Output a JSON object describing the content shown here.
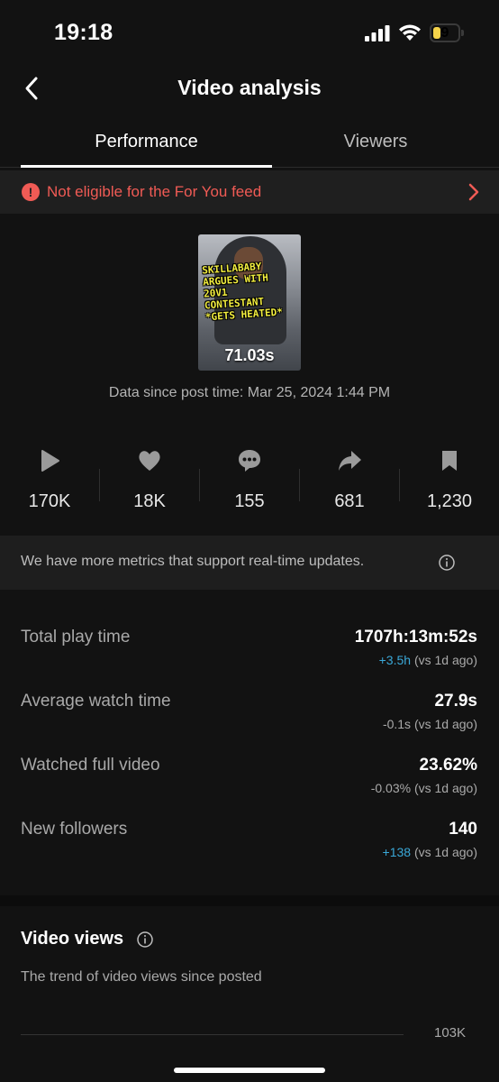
{
  "status_bar": {
    "time": "19:18",
    "battery_level": "9",
    "battery_color": "#f5d34a"
  },
  "header": {
    "title": "Video analysis"
  },
  "tabs": [
    {
      "label": "Performance",
      "active": true
    },
    {
      "label": "Viewers",
      "active": false
    }
  ],
  "alert": {
    "text": "Not eligible for the For You feed",
    "color": "#f05b55"
  },
  "video": {
    "caption_lines": [
      "SKILLABABY",
      "ARGUES WITH",
      "20V1",
      "CONTESTANT",
      "*GETS HEATED*"
    ],
    "duration": "71.03s",
    "data_since": "Data since post time: Mar 25, 2024 1:44 PM"
  },
  "metrics": [
    {
      "icon": "play-icon",
      "value": "170K"
    },
    {
      "icon": "heart-icon",
      "value": "18K"
    },
    {
      "icon": "comment-icon",
      "value": "155"
    },
    {
      "icon": "share-icon",
      "value": "681"
    },
    {
      "icon": "bookmark-icon",
      "value": "1,230"
    }
  ],
  "realtime_notice": "We have more metrics that support real-time updates.",
  "stats": [
    {
      "label": "Total play time",
      "value": "1707h:13m:52s",
      "change": "+3.5h",
      "suffix": " (vs 1d ago)",
      "positive": true
    },
    {
      "label": "Average watch time",
      "value": "27.9s",
      "change": "-0.1s",
      "suffix": " (vs 1d ago)",
      "positive": false
    },
    {
      "label": "Watched full video",
      "value": "23.62%",
      "change": "-0.03%",
      "suffix": " (vs 1d ago)",
      "positive": false
    },
    {
      "label": "New followers",
      "value": "140",
      "change": "+138",
      "suffix": " (vs 1d ago)",
      "positive": true
    }
  ],
  "video_views": {
    "title": "Video views",
    "subtitle": "The trend of video views since posted",
    "y_tick_top": "103K"
  },
  "colors": {
    "accent_positive": "#3aa8d8",
    "background": "#121212"
  }
}
